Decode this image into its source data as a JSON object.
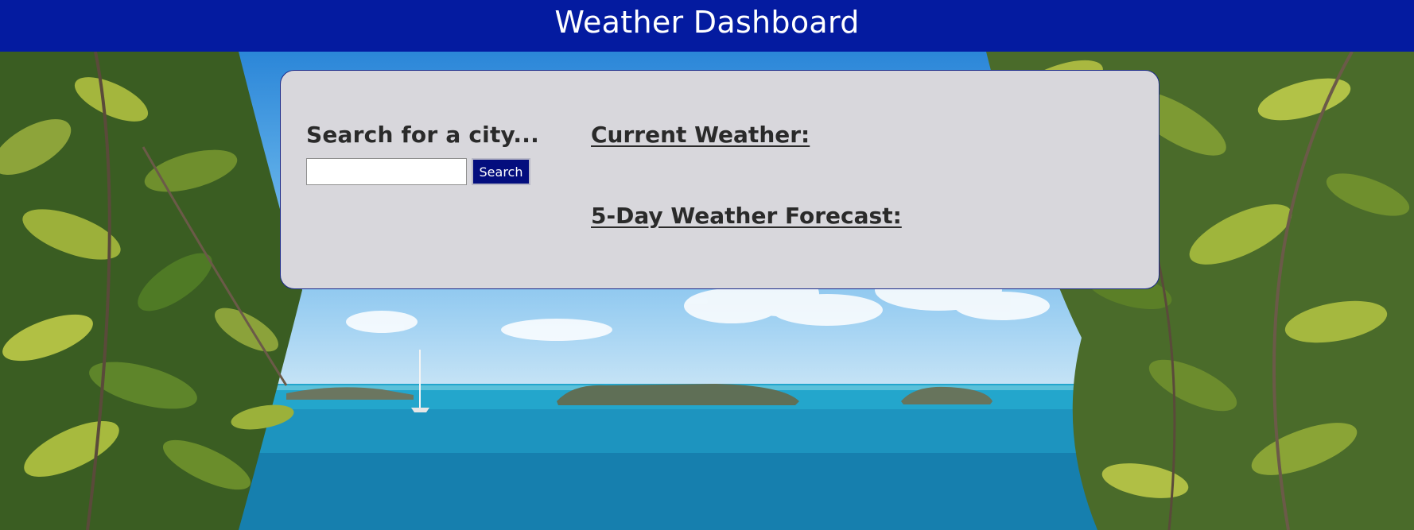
{
  "header": {
    "title": "Weather Dashboard"
  },
  "search": {
    "heading": "Search for a city...",
    "input_value": "",
    "input_placeholder": "",
    "button_label": "Search"
  },
  "current_weather": {
    "heading": "Current Weather:"
  },
  "forecast": {
    "heading": "5-Day Weather Forecast:"
  },
  "colors": {
    "header_background": "#041ba0",
    "card_background": "#d8d7dc",
    "button_background": "#040e7e",
    "text": "#2a2a2a"
  }
}
